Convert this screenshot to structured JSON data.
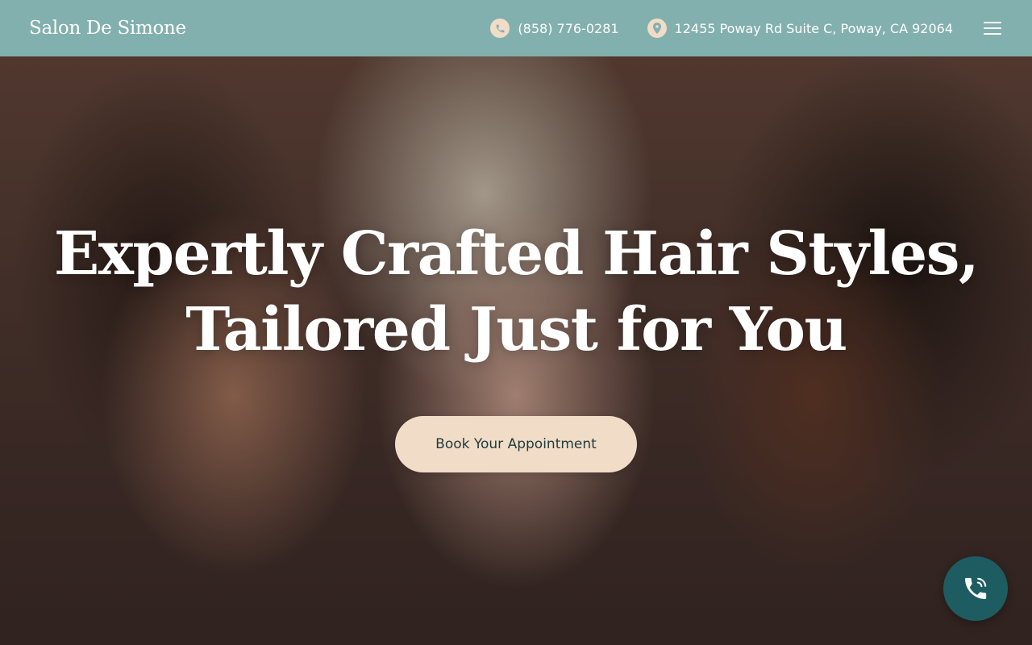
{
  "header": {
    "logo": "Salon De Simone",
    "phone": "(858) 776-0281",
    "address": "12455 Poway Rd Suite C, Poway, CA 92064",
    "phone_icon": "phone-icon",
    "address_icon": "map-pin-icon",
    "menu_icon": "hamburger-menu-icon"
  },
  "hero": {
    "title_line1": "Expertly Crafted Hair Styles,",
    "title_line2": "Tailored Just for You",
    "cta_label": "Book Your Appointment"
  },
  "floating": {
    "call_icon": "phone-call-icon"
  },
  "colors": {
    "header_bg": "#82b0ae",
    "accent_cream": "#f1dcc7",
    "button_text": "#1f3b3d",
    "fab_bg": "#1d5d62"
  }
}
